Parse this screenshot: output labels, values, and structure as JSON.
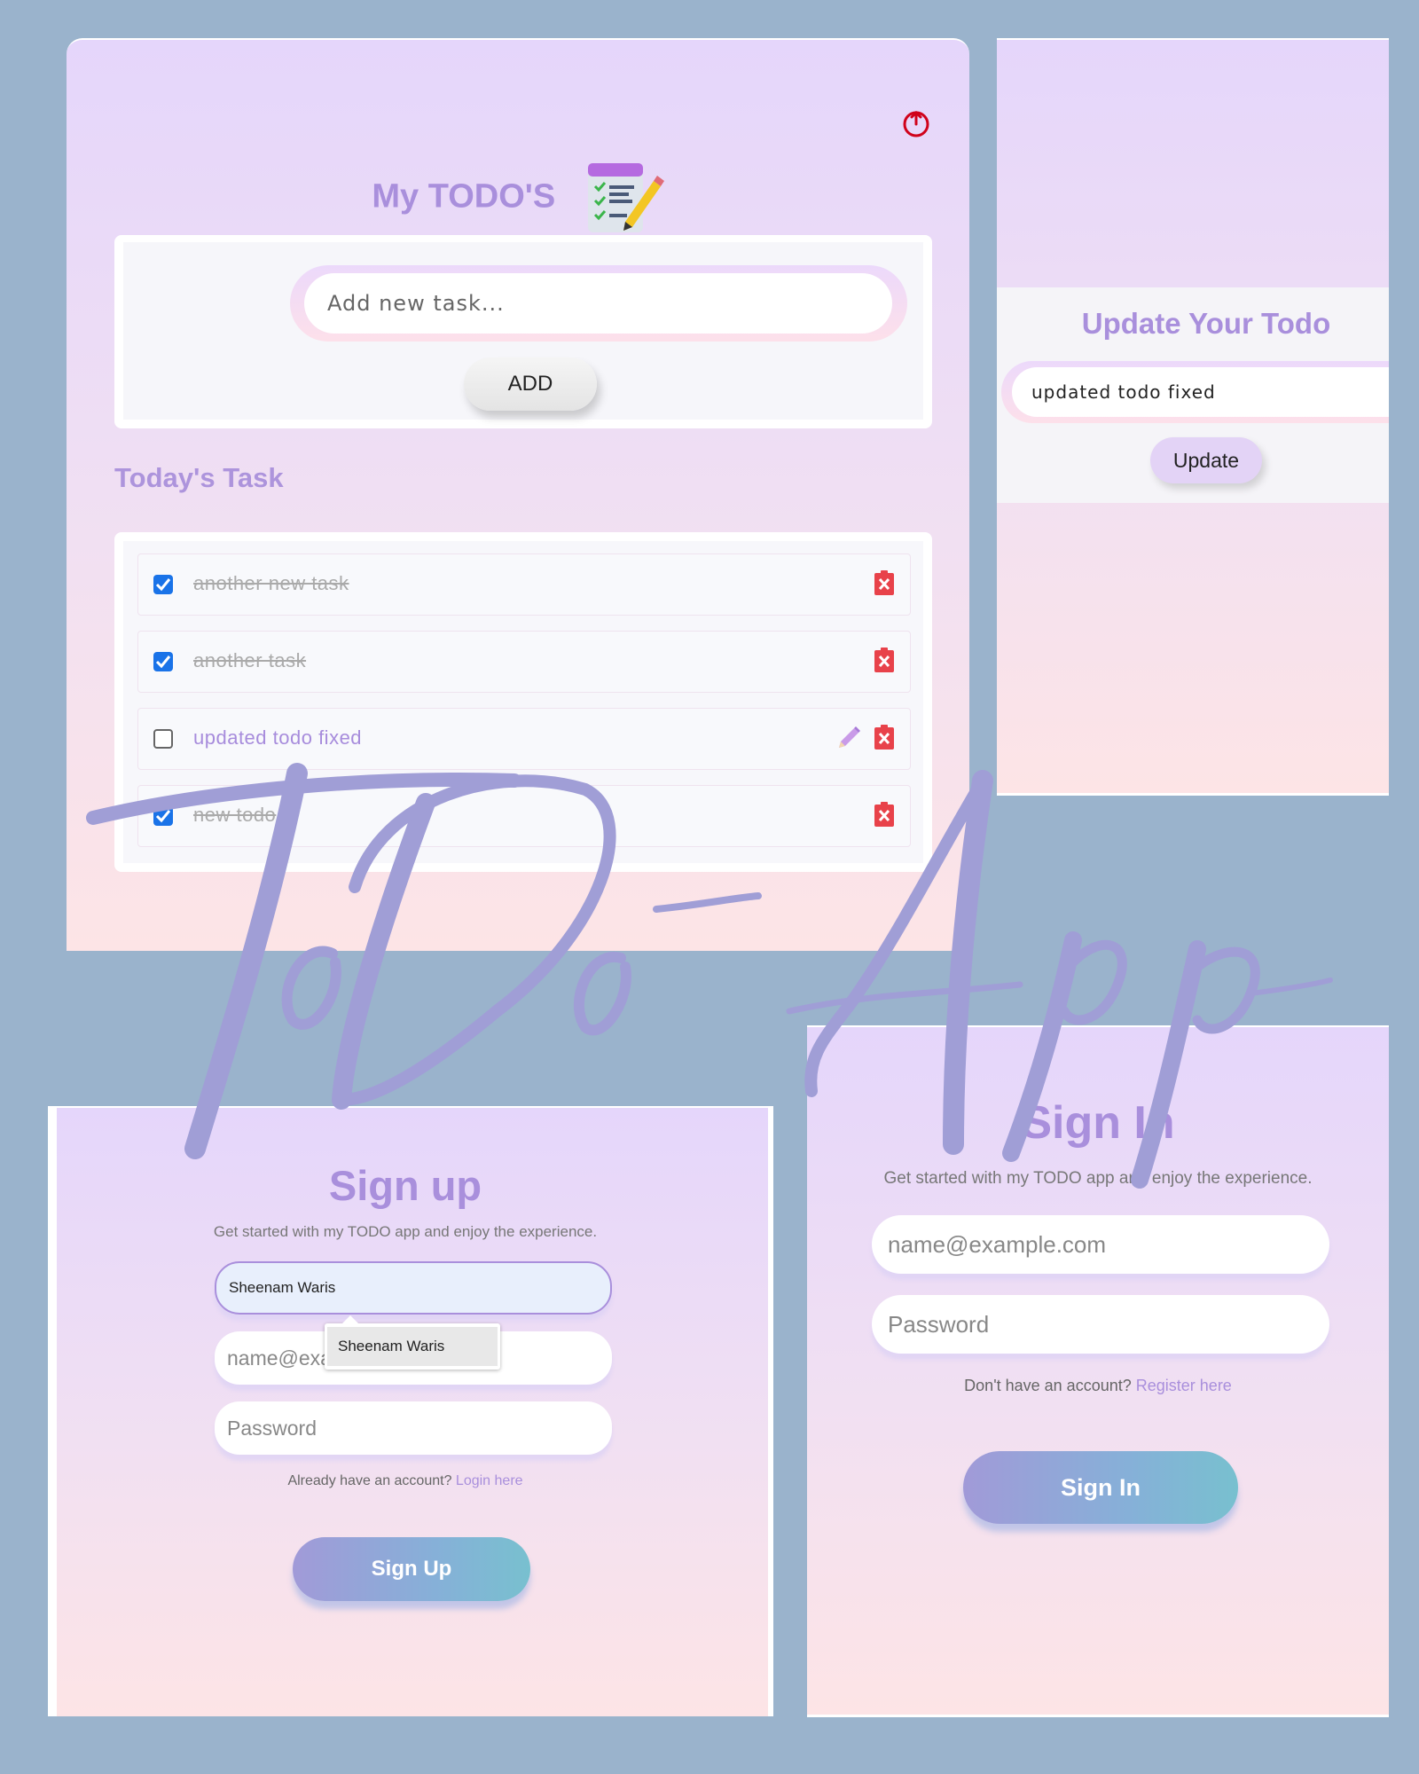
{
  "todo_app": {
    "title": "My TODO'S",
    "task_input_placeholder": "Add new task...",
    "add_label": "ADD",
    "section_title": "Today's Task",
    "tasks": [
      {
        "text": "another new task",
        "done": true
      },
      {
        "text": "another task",
        "done": true
      },
      {
        "text": "updated todo fixed",
        "done": false
      },
      {
        "text": "new todo",
        "done": true
      }
    ],
    "colors": {
      "accent": "#a98fdc",
      "delete": "#e8424a",
      "checkbox": "#1a73e8",
      "power": "#d0021b"
    }
  },
  "update_view": {
    "title": "Update Your Todo",
    "input_value": "updated todo fixed",
    "button_label": "Update"
  },
  "signup": {
    "title": "Sign up",
    "subtitle": "Get started with my TODO app and enjoy the experience.",
    "name_value": "Sheenam Waris",
    "autofill_suggestion": "Sheenam Waris",
    "email_placeholder": "name@example.com",
    "password_placeholder": "Password",
    "login_prompt": "Already have an account?",
    "login_link": "Login here",
    "button_label": "Sign Up"
  },
  "signin": {
    "title": "Sign In",
    "subtitle": "Get started with my TODO app and enjoy the experience.",
    "email_placeholder": "name@example.com",
    "password_placeholder": "Password",
    "register_prompt": "Don't have an account?",
    "register_link": "Register here",
    "button_label": "Sign In"
  },
  "watermark_text": "ToDo-App"
}
